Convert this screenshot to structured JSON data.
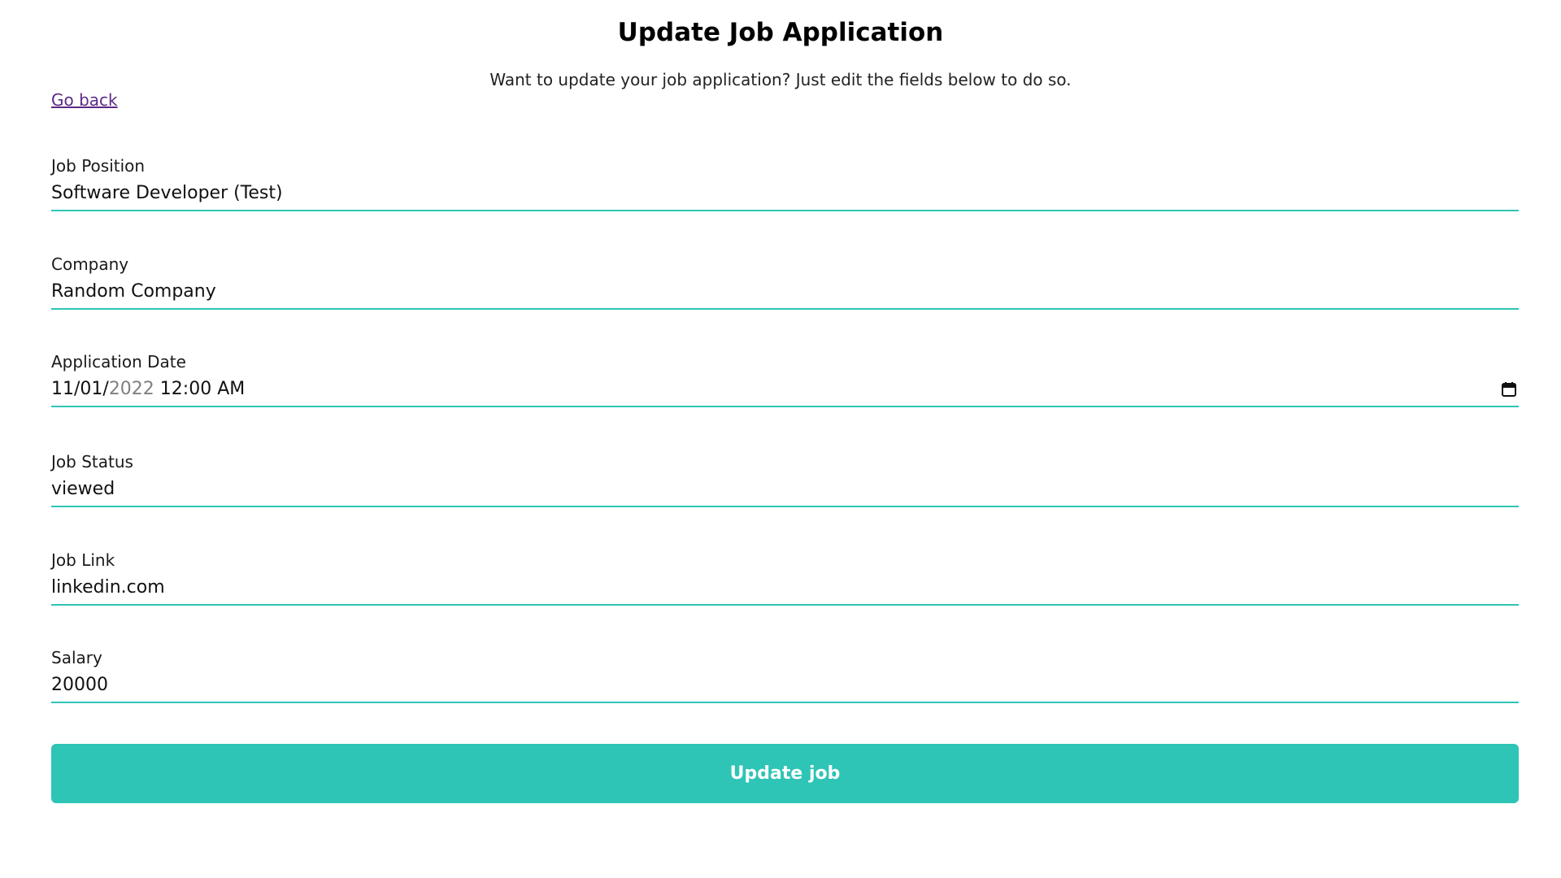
{
  "header": {
    "title": "Update Job Application",
    "subtitle": "Want to update your job application? Just edit the fields below to do so."
  },
  "nav": {
    "go_back": "Go back"
  },
  "form": {
    "job_position": {
      "label": "Job Position",
      "value": "Software Developer (Test)"
    },
    "company": {
      "label": "Company",
      "value": "Random Company"
    },
    "application_date": {
      "label": "Application Date",
      "value_prefix": "11/01/",
      "value_year": "2022",
      "value_time": " 12:00 AM",
      "icon": "calendar-icon"
    },
    "job_status": {
      "label": "Job Status",
      "value": "viewed"
    },
    "job_link": {
      "label": "Job Link",
      "value": "linkedin.com"
    },
    "salary": {
      "label": "Salary",
      "value": "20000"
    },
    "submit_label": "Update job"
  },
  "colors": {
    "accent": "#2ec4b6",
    "link": "#5b2a86"
  }
}
